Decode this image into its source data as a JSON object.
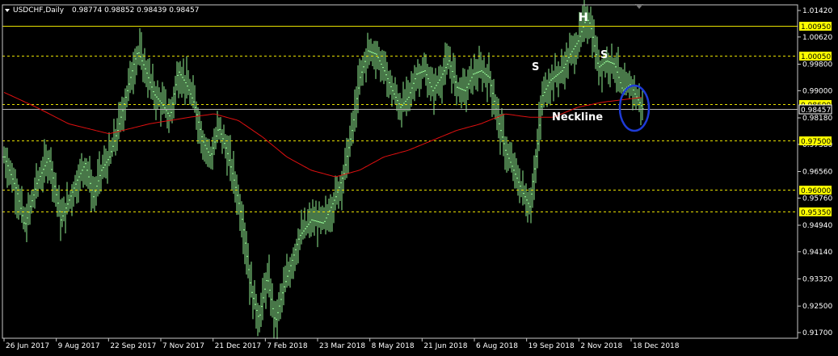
{
  "header": {
    "symbol": "USDCHF,Daily",
    "ohlc": "0.98774 0.98852 0.98439 0.98457"
  },
  "chart_data": {
    "type": "bar",
    "price_axis": {
      "range": [
        0.917,
        1.0142
      ],
      "ticks": [
        "1.01420",
        "1.00620",
        "0.99800",
        "0.99000",
        "0.98180",
        "0.97380",
        "0.96560",
        "0.95760",
        "0.94940",
        "0.94140",
        "0.93320",
        "0.92500",
        "0.91700"
      ]
    },
    "date_axis": [
      "26 Jun 2017",
      "9 Aug 2017",
      "22 Sep 2017",
      "7 Nov 2017",
      "21 Dec 2017",
      "7 Feb 2018",
      "23 Mar 2018",
      "8 May 2018",
      "21 Jun 2018",
      "6 Aug 2018",
      "19 Sep 2018",
      "2 Nov 2018",
      "18 Dec 2018"
    ],
    "levels": [
      {
        "value": 1.0095,
        "label": "1.00950",
        "style": "solid"
      },
      {
        "value": 1.0005,
        "label": "1.00050",
        "style": "dashed"
      },
      {
        "value": 0.986,
        "label": "0.98600",
        "style": "dashed"
      },
      {
        "value": 0.975,
        "label": "0.97500",
        "style": "dashed"
      },
      {
        "value": 0.96,
        "label": "0.96000",
        "style": "dashed"
      },
      {
        "value": 0.9535,
        "label": "0.95350",
        "style": "dashed"
      }
    ],
    "current_price": {
      "value": 0.98457,
      "label": "0.98457"
    },
    "series": [
      {
        "kind": "price",
        "color": "#90ee90",
        "keypoints": [
          [
            0,
            0.97
          ],
          [
            15,
            0.96
          ],
          [
            25,
            0.949
          ],
          [
            40,
            0.962
          ],
          [
            55,
            0.97
          ],
          [
            70,
            0.951
          ],
          [
            90,
            0.963
          ],
          [
            100,
            0.968
          ],
          [
            110,
            0.958
          ],
          [
            120,
            0.966
          ],
          [
            130,
            0.97
          ],
          [
            140,
            0.978
          ],
          [
            150,
            0.988
          ],
          [
            160,
            0.998
          ],
          [
            165,
            1.002
          ],
          [
            175,
            0.996
          ],
          [
            185,
            0.989
          ],
          [
            195,
            0.986
          ],
          [
            205,
            0.982
          ],
          [
            215,
            0.996
          ],
          [
            225,
            0.992
          ],
          [
            235,
            0.986
          ],
          [
            245,
            0.975
          ],
          [
            255,
            0.97
          ],
          [
            265,
            0.979
          ],
          [
            275,
            0.972
          ],
          [
            285,
            0.962
          ],
          [
            295,
            0.95
          ],
          [
            305,
            0.93
          ],
          [
            315,
            0.921
          ],
          [
            325,
            0.934
          ],
          [
            335,
            0.92
          ],
          [
            345,
            0.93
          ],
          [
            355,
            0.938
          ],
          [
            365,
            0.946
          ],
          [
            380,
            0.951
          ],
          [
            395,
            0.95
          ],
          [
            410,
            0.958
          ],
          [
            420,
            0.965
          ],
          [
            430,
            0.978
          ],
          [
            440,
            0.994
          ],
          [
            450,
            1.002
          ],
          [
            460,
            1.001
          ],
          [
            470,
            0.996
          ],
          [
            480,
            0.99
          ],
          [
            490,
            0.985
          ],
          [
            500,
            0.988
          ],
          [
            510,
            0.995
          ],
          [
            520,
            0.996
          ],
          [
            530,
            0.99
          ],
          [
            540,
            0.994
          ],
          [
            550,
            0.999
          ],
          [
            560,
            0.991
          ],
          [
            570,
            0.99
          ],
          [
            580,
            0.995
          ],
          [
            590,
            0.996
          ],
          [
            600,
            0.994
          ],
          [
            610,
            0.982
          ],
          [
            620,
            0.972
          ],
          [
            630,
            0.966
          ],
          [
            640,
            0.96
          ],
          [
            650,
            0.955
          ],
          [
            660,
            0.974
          ],
          [
            665,
            0.988
          ],
          [
            675,
            0.993
          ],
          [
            690,
            0.996
          ],
          [
            700,
            1.001
          ],
          [
            710,
            1.005
          ],
          [
            720,
            1.012
          ],
          [
            725,
            1.01
          ],
          [
            735,
            0.997
          ],
          [
            745,
            0.999
          ],
          [
            755,
            0.998
          ],
          [
            765,
            0.99
          ],
          [
            775,
            0.992
          ],
          [
            780,
            0.989
          ],
          [
            790,
            0.9846
          ]
        ]
      },
      {
        "kind": "moving-average",
        "color": "#e01010",
        "keypoints": [
          [
            0,
            0.9895
          ],
          [
            40,
            0.985
          ],
          [
            80,
            0.98
          ],
          [
            130,
            0.977
          ],
          [
            180,
            0.98
          ],
          [
            230,
            0.982
          ],
          [
            260,
            0.983
          ],
          [
            290,
            0.981
          ],
          [
            320,
            0.976
          ],
          [
            350,
            0.97
          ],
          [
            380,
            0.966
          ],
          [
            410,
            0.964
          ],
          [
            440,
            0.966
          ],
          [
            470,
            0.97
          ],
          [
            500,
            0.972
          ],
          [
            530,
            0.975
          ],
          [
            560,
            0.978
          ],
          [
            590,
            0.98
          ],
          [
            620,
            0.983
          ],
          [
            650,
            0.982
          ],
          [
            680,
            0.982
          ],
          [
            710,
            0.985
          ],
          [
            740,
            0.9865
          ],
          [
            790,
            0.988
          ]
        ]
      }
    ],
    "annotations": [
      {
        "text": "H",
        "value": 1.0136
      },
      {
        "text": "S",
        "value": 1.0005
      },
      {
        "text": "S",
        "value": 1.003
      },
      {
        "text": "Neckline",
        "value": 0.983
      }
    ]
  }
}
